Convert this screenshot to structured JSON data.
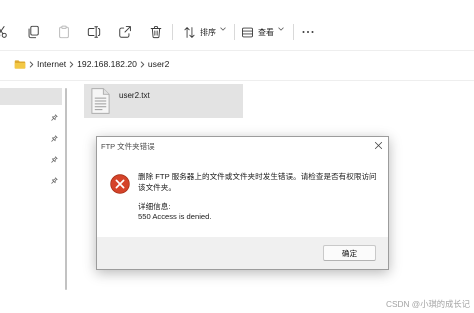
{
  "toolbar": {
    "cut": {
      "icon": "scissors-icon"
    },
    "copy": {
      "icon": "copy-icon"
    },
    "paste": {
      "icon": "paste-icon",
      "enabled": false
    },
    "rename": {
      "icon": "rename-icon"
    },
    "share": {
      "icon": "share-icon"
    },
    "delete": {
      "icon": "trash-icon"
    },
    "sort": {
      "icon": "sort-icon",
      "label": "排序",
      "chevron": "chevron-down-icon"
    },
    "view": {
      "icon": "view-icon",
      "label": "查看",
      "chevron": "chevron-down-icon"
    },
    "more": {
      "icon": "more-icon"
    }
  },
  "address_bar": {
    "location_icon": "folder-icon",
    "separator_icon": "chevron-right-icon",
    "crumbs": [
      "Internet",
      "192.168.182.20",
      "user2"
    ]
  },
  "navigation_pane": {
    "pin_icon": "pin-icon"
  },
  "files": [
    {
      "name": "user2.txt",
      "icon": "text-file-icon",
      "selected": true
    }
  ],
  "dialog": {
    "title": "FTP 文件夹错误",
    "close_icon": "close-icon",
    "icon": "error-icon",
    "message_line1": "删除 FTP 服务器上的文件或文件夹时发生错误。请检查是否有权限访问",
    "message_line2": "该文件夹。",
    "details_label": "详细信息:",
    "details_text": "550 Access is denied.",
    "ok_label": "确定"
  },
  "watermark": "CSDN @小琪的成长记",
  "colors": {
    "error_red": "#d5432a",
    "folder_yellow": "#f3c845",
    "selection_grey": "#e3e3e3",
    "dialog_footer": "#f0f0f0"
  }
}
